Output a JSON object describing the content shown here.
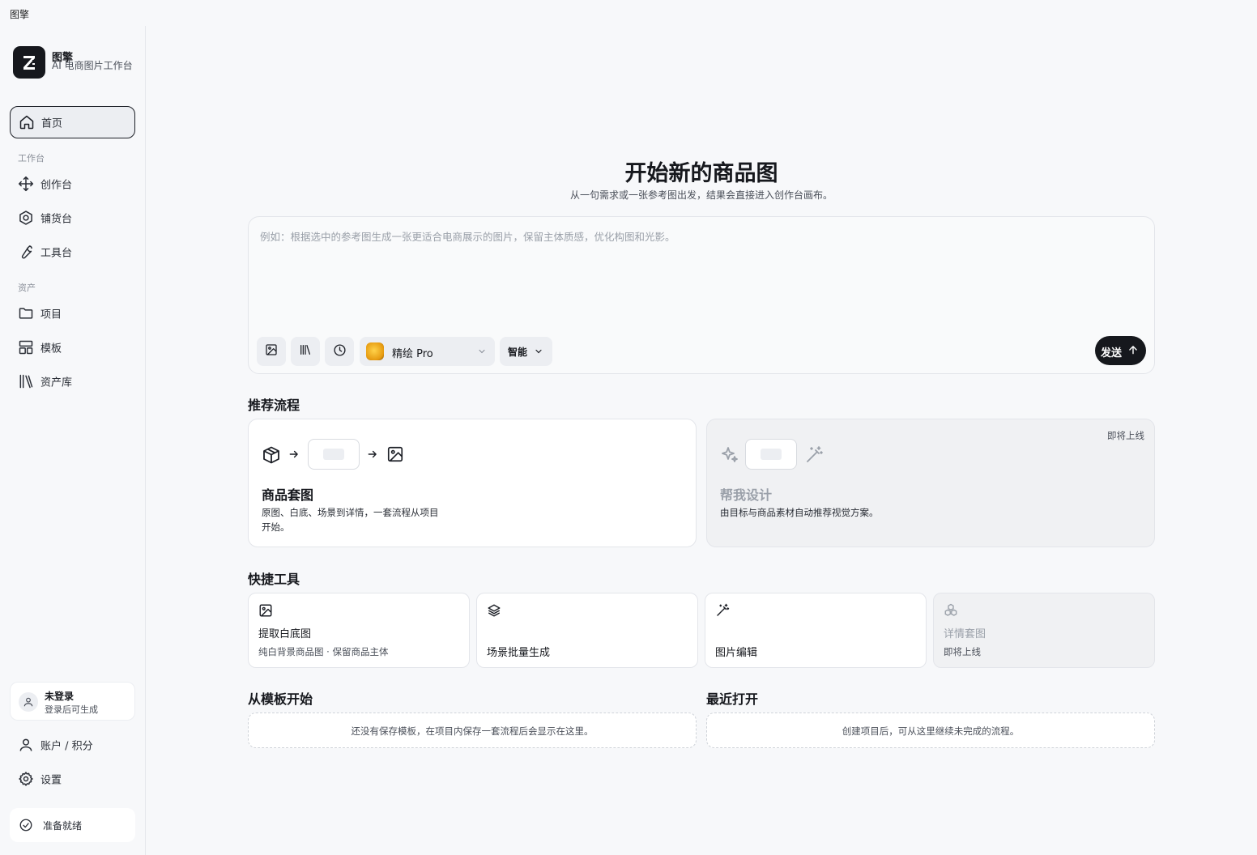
{
  "window": {
    "title": "图擎"
  },
  "brand": {
    "name": "图擎",
    "subtitle": "AI 电商图片工作台",
    "logo_icon": "z-logo-icon"
  },
  "sidebar": {
    "home": {
      "label": "首页",
      "icon": "home-icon"
    },
    "section_workbench": "工作台",
    "workbench_items": [
      {
        "label": "创作台",
        "icon": "move-arrows-icon"
      },
      {
        "label": "铺货台",
        "icon": "hexagon-icon"
      },
      {
        "label": "工具台",
        "icon": "wrench-icon"
      }
    ],
    "section_assets": "资产",
    "asset_items": [
      {
        "label": "项目",
        "icon": "folder-icon"
      },
      {
        "label": "模板",
        "icon": "layout-icon"
      },
      {
        "label": "资产库",
        "icon": "library-icon"
      }
    ],
    "user": {
      "name": "未登录",
      "hint": "登录后可生成",
      "icon": "user-icon"
    },
    "account": {
      "label": "账户 / 积分",
      "icon": "user-icon"
    },
    "settings": {
      "label": "设置",
      "icon": "gear-icon"
    },
    "status": {
      "label": "准备就绪",
      "icon": "check-circle-icon"
    }
  },
  "hero": {
    "title": "开始新的商品图",
    "subtitle": "从一句需求或一张参考图出发，结果会直接进入创作台画布。"
  },
  "composer": {
    "placeholder": "例如：根据选中的参考图生成一张更适合电商展示的图片，保留主体质感，优化构图和光影。",
    "value": "",
    "model": "精绘 Pro",
    "mode": "智能",
    "send_label": "发送"
  },
  "recommended": {
    "title": "推荐流程",
    "cards": [
      {
        "title": "商品套图",
        "desc": "原图、白底、场景到详情，一套流程从项目开始。",
        "badge": ""
      },
      {
        "title": "帮我设计",
        "desc": "由目标与商品素材自动推荐视觉方案。",
        "badge": "即将上线"
      }
    ]
  },
  "quick_tools": {
    "title": "快捷工具",
    "items": [
      {
        "title": "提取白底图",
        "desc": "纯白背景商品图 · 保留商品主体",
        "icon": "image-icon"
      },
      {
        "title": "场景批量生成",
        "desc": "",
        "icon": "layers-icon"
      },
      {
        "title": "图片编辑",
        "desc": "",
        "icon": "magic-wand-icon"
      },
      {
        "title": "详情套图",
        "desc": "即将上线",
        "icon": "cubes-icon"
      }
    ]
  },
  "templates": {
    "title": "从模板开始",
    "empty": "还没有保存模板，在项目内保存一套流程后会显示在这里。"
  },
  "recent": {
    "title": "最近打开",
    "empty": "创建项目后，可从这里继续未完成的流程。"
  },
  "colors": {
    "accent": "#16181d",
    "background": "#f7f8fa",
    "card": "#ffffff",
    "muted": "#9aa0a9"
  }
}
